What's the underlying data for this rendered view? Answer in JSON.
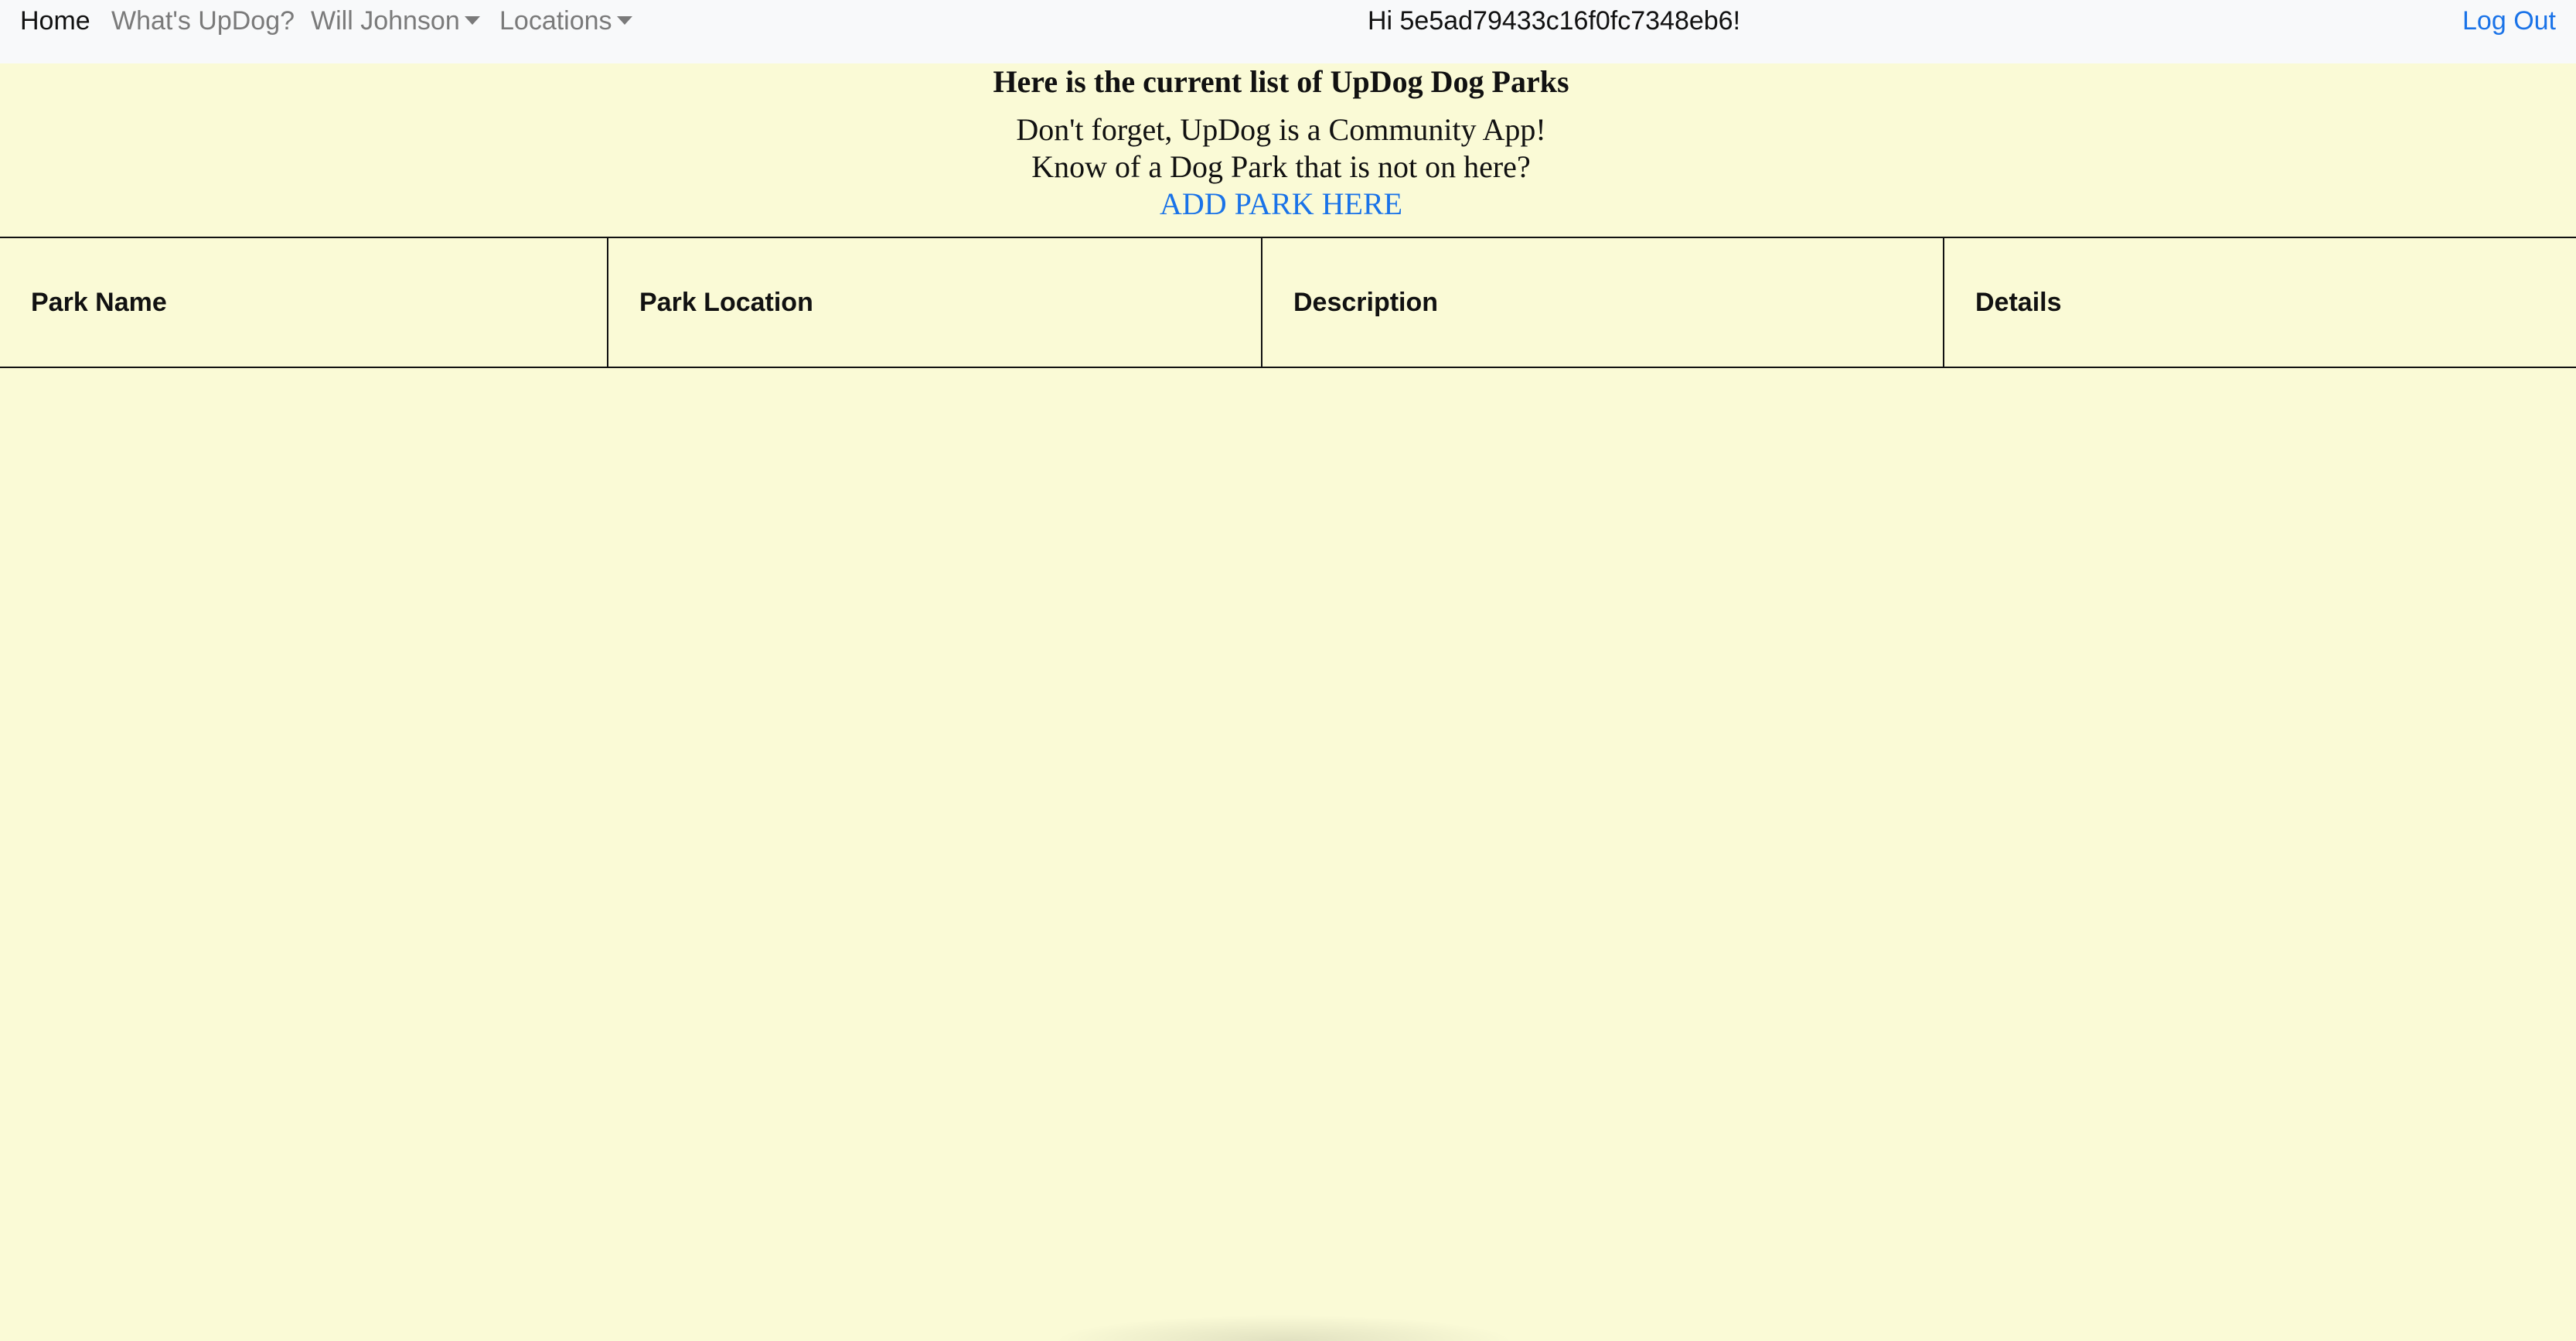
{
  "navbar": {
    "items": [
      {
        "label": "Home",
        "active": true
      },
      {
        "label": "What's UpDog?",
        "active": false
      },
      {
        "label": "Will Johnson",
        "dropdown": true
      },
      {
        "label": "Locations",
        "dropdown": true
      }
    ],
    "greeting": "Hi 5e5ad79433c16f0fc7348eb6!",
    "logout_label": "Log Out"
  },
  "intro": {
    "heading": "Here is the current list of UpDog Dog Parks",
    "line1": "Don't forget, UpDog is a Community App!",
    "line2": "Know of a Dog Park that is not on here?",
    "add_link": "ADD PARK HERE"
  },
  "table": {
    "headers": [
      "Park Name",
      "Park Location",
      "Description",
      "Details"
    ],
    "rows": []
  },
  "colors": {
    "page_background": "#fafad6",
    "navbar_background": "#f8f9fa",
    "link": "#1a73e8",
    "muted_nav": "#7a7a7a"
  }
}
